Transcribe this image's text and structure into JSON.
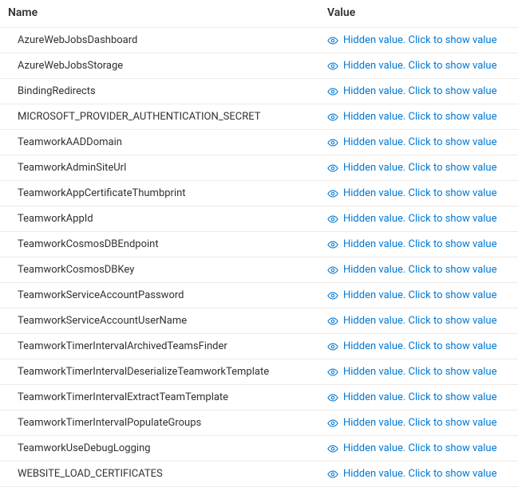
{
  "headers": {
    "name": "Name",
    "value": "Value"
  },
  "hidden_value_text": "Hidden value. Click to show value",
  "settings": [
    {
      "name": "AzureWebJobsDashboard"
    },
    {
      "name": "AzureWebJobsStorage"
    },
    {
      "name": "BindingRedirects"
    },
    {
      "name": "MICROSOFT_PROVIDER_AUTHENTICATION_SECRET"
    },
    {
      "name": "TeamworkAADDomain"
    },
    {
      "name": "TeamworkAdminSiteUrl"
    },
    {
      "name": "TeamworkAppCertificateThumbprint"
    },
    {
      "name": "TeamworkAppId"
    },
    {
      "name": "TeamworkCosmosDBEndpoint"
    },
    {
      "name": "TeamworkCosmosDBKey"
    },
    {
      "name": "TeamworkServiceAccountPassword"
    },
    {
      "name": "TeamworkServiceAccountUserName"
    },
    {
      "name": "TeamworkTimerIntervalArchivedTeamsFinder"
    },
    {
      "name": "TeamworkTimerIntervalDeserializeTeamworkTemplate"
    },
    {
      "name": "TeamworkTimerIntervalExtractTeamTemplate"
    },
    {
      "name": "TeamworkTimerIntervalPopulateGroups"
    },
    {
      "name": "TeamworkUseDebugLogging"
    },
    {
      "name": "WEBSITE_LOAD_CERTIFICATES"
    }
  ]
}
